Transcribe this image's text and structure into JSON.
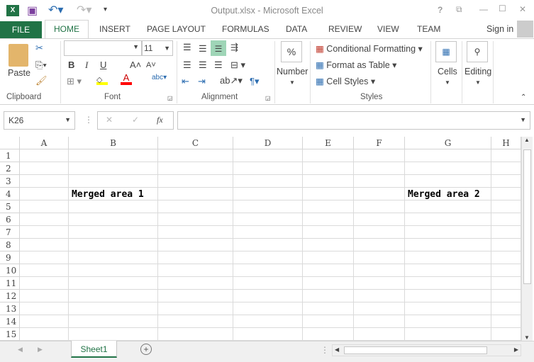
{
  "window": {
    "title": "Output.xlsx - Microsoft Excel",
    "controls": [
      "?",
      "⧉",
      "—",
      "☐",
      "✕"
    ]
  },
  "menu": {
    "file": "FILE",
    "tabs": [
      "HOME",
      "INSERT",
      "PAGE LAYOUT",
      "FORMULAS",
      "DATA",
      "REVIEW",
      "VIEW",
      "TEAM"
    ],
    "sign_in": "Sign in"
  },
  "ribbon": {
    "clipboard": {
      "label": "Clipboard",
      "paste": "Paste"
    },
    "font": {
      "label": "Font",
      "font_name": "",
      "font_size": "11",
      "bold": "B",
      "italic": "I",
      "underline": "U"
    },
    "alignment": {
      "label": "Alignment"
    },
    "number": {
      "label": "Number",
      "symbol": "%"
    },
    "styles": {
      "label": "Styles",
      "items": [
        "Conditional Formatting",
        "Format as Table",
        "Cell Styles"
      ]
    },
    "cells": {
      "label": "Cells"
    },
    "editing": {
      "label": "Editing"
    }
  },
  "formula_bar": {
    "name_box": "K26",
    "fx": "fx",
    "value": ""
  },
  "sheet": {
    "columns": [
      "A",
      "B",
      "C",
      "D",
      "E",
      "F",
      "G",
      "H"
    ],
    "rows": [
      "1",
      "2",
      "3",
      "4",
      "5",
      "6",
      "7",
      "8",
      "9",
      "10",
      "11",
      "12",
      "13",
      "14",
      "15"
    ],
    "cells": {
      "B4": "Merged area 1",
      "G4": "Merged area 2"
    }
  },
  "tabs": {
    "sheets": [
      "Sheet1"
    ],
    "active": "Sheet1"
  },
  "colors": {
    "accent": "#217346",
    "highlight": "#ffff00",
    "font_color": "#ff0000"
  }
}
